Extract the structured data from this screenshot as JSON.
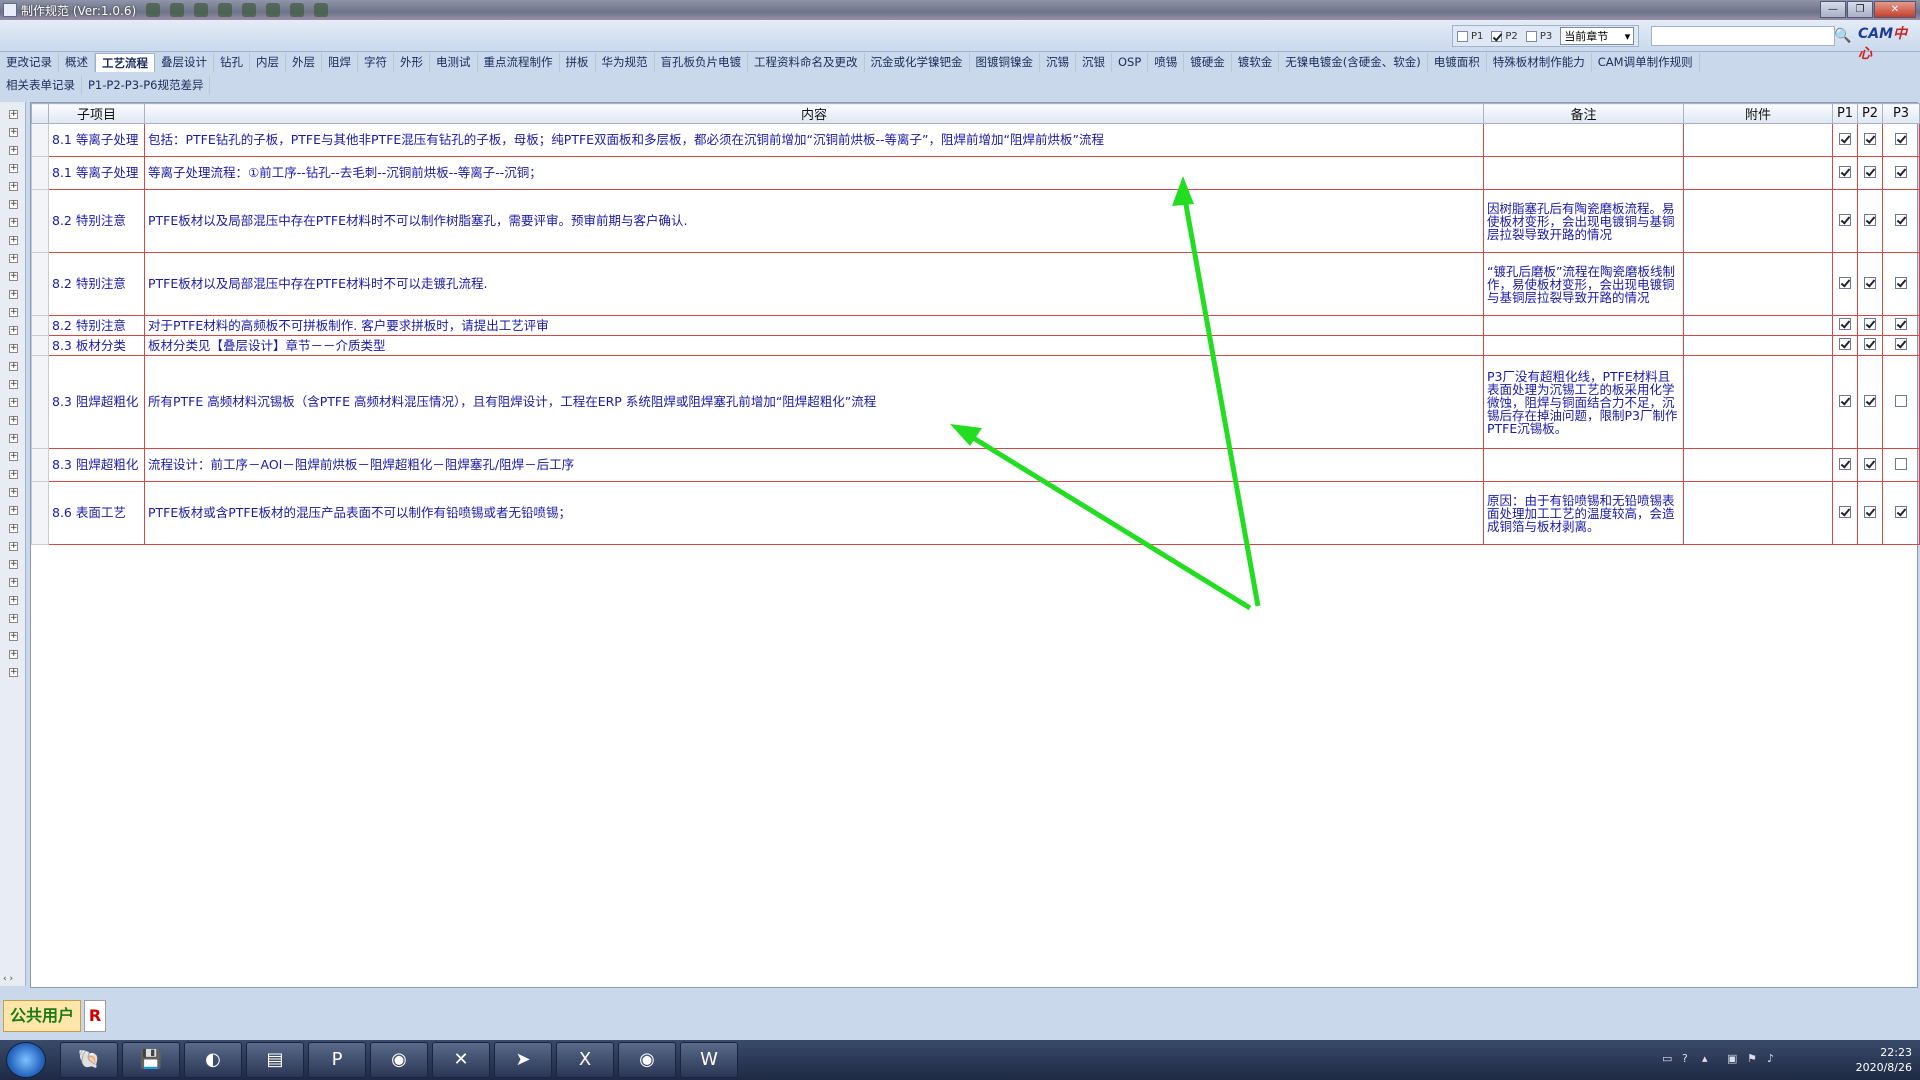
{
  "window": {
    "title": "制作规范 (Ver:1.0.6)"
  },
  "toolbar": {
    "filters": [
      {
        "label": "P1",
        "checked": false
      },
      {
        "label": "P2",
        "checked": true
      },
      {
        "label": "P3",
        "checked": false
      }
    ],
    "scope_select": "当前章节",
    "search_placeholder": "",
    "logo_main": "CAM",
    "logo_accent": "中心"
  },
  "tabs_row1": [
    "更改记录",
    "概述",
    "工艺流程",
    "叠层设计",
    "钻孔",
    "内层",
    "外层",
    "阻焊",
    "字符",
    "外形",
    "电测试",
    "重点流程制作",
    "拼板",
    "华为规范",
    "盲孔板负片电镀",
    "工程资料命名及更改",
    "沉金或化学镍钯金",
    "图镀铜镍金",
    "沉锡",
    "沉银",
    "OSP",
    "喷锡",
    "镀硬金",
    "镀软金",
    "无镍电镀金(含硬金、软金)",
    "电镀面积",
    "特殊板材制作能力",
    "CAM调单制作规则"
  ],
  "active_tab": "工艺流程",
  "tabs_row2": [
    "相关表单记录",
    "P1-P2-P3-P6规范差异"
  ],
  "table": {
    "headers": {
      "sub": "子项目",
      "content": "内容",
      "note": "备注",
      "attachment": "附件",
      "p1": "P1",
      "p2": "P2",
      "p3": "P3"
    },
    "rows": [
      {
        "sub": "8.1 等离子处理",
        "content": "包括：PTFE钻孔的子板，PTFE与其他非PTFE混压有钻孔的子板，母板；纯PTFE双面板和多层板，都必须在沉铜前增加“沉铜前烘板--等离子”，阻焊前增加“阻焊前烘板”流程",
        "note": "",
        "attachment": "",
        "p1": true,
        "p2": true,
        "p3": true
      },
      {
        "sub": "8.1 等离子处理",
        "content": "等离子处理流程：①前工序--钻孔--去毛刺--沉铜前烘板--等离子--沉铜；",
        "note": "",
        "attachment": "",
        "p1": true,
        "p2": true,
        "p3": true
      },
      {
        "sub": "8.2 特别注意",
        "content": "PTFE板材以及局部混压中存在PTFE材料时不可以制作树脂塞孔，需要评审。预审前期与客户确认.",
        "note": "因树脂塞孔后有陶瓷磨板流程。易使板材变形，会出现电镀铜与基铜层拉裂导致开路的情况",
        "attachment": "",
        "p1": true,
        "p2": true,
        "p3": true
      },
      {
        "sub": "8.2 特别注意",
        "content": "PTFE板材以及局部混压中存在PTFE材料时不可以走镀孔流程.",
        "note": "“镀孔后磨板”流程在陶瓷磨板线制作，易使板材变形，会出现电镀铜与基铜层拉裂导致开路的情况",
        "attachment": "",
        "p1": true,
        "p2": true,
        "p3": true
      },
      {
        "sub": "8.2 特别注意",
        "content": "对于PTFE材料的高频板不可拼板制作. 客户要求拼板时，请提出工艺评审",
        "note": "",
        "attachment": "",
        "p1": true,
        "p2": true,
        "p3": true
      },
      {
        "sub": "8.3 板材分类",
        "content": "板材分类见【叠层设计】章节－－介质类型",
        "note": "",
        "attachment": "",
        "p1": true,
        "p2": true,
        "p3": true
      },
      {
        "sub": "8.3 阻焊超粗化",
        "content": "所有PTFE 高频材料沉锡板（含PTFE 高频材料混压情况），且有阻焊设计，工程在ERP 系统阻焊或阻焊塞孔前增加“阻焊超粗化”流程",
        "note": "P3厂没有超粗化线，PTFE材料且表面处理为沉锡工艺的板采用化学微蚀，阻焊与铜面结合力不足，沉锡后存在掉油问题，限制P3厂制作PTFE沉锡板。",
        "attachment": "",
        "p1": true,
        "p2": true,
        "p3": false
      },
      {
        "sub": "8.3 阻焊超粗化",
        "content": "流程设计：前工序－AOI－阻焊前烘板－阻焊超粗化－阻焊塞孔/阻焊－后工序",
        "note": "",
        "attachment": "",
        "p1": true,
        "p2": true,
        "p3": false
      },
      {
        "sub": "8.6 表面工艺",
        "content": "PTFE板材或含PTFE板材的混压产品表面不可以制作有铅喷锡或者无铅喷锡；",
        "note": "原因：由于有铅喷锡和无铅喷锡表面处理加工工艺的温度较高，会造成铜箔与板材剥离。",
        "attachment": "",
        "p1": true,
        "p2": true,
        "p3": true
      }
    ]
  },
  "statusbar": {
    "user": "公共用户",
    "role": "R"
  },
  "taskbar": {
    "apps": [
      "shell-icon",
      "save-icon",
      "reader-icon",
      "notepad-icon",
      "app-p-icon",
      "eye-icon",
      "x-icon",
      "send-icon",
      "excel-icon",
      "eye2-icon",
      "word-icon"
    ],
    "time": "22:23",
    "date": "2020/8/26"
  },
  "colors": {
    "grid_border": "#d44848",
    "text": "#1a1aa8",
    "arrow": "#22dd22"
  }
}
